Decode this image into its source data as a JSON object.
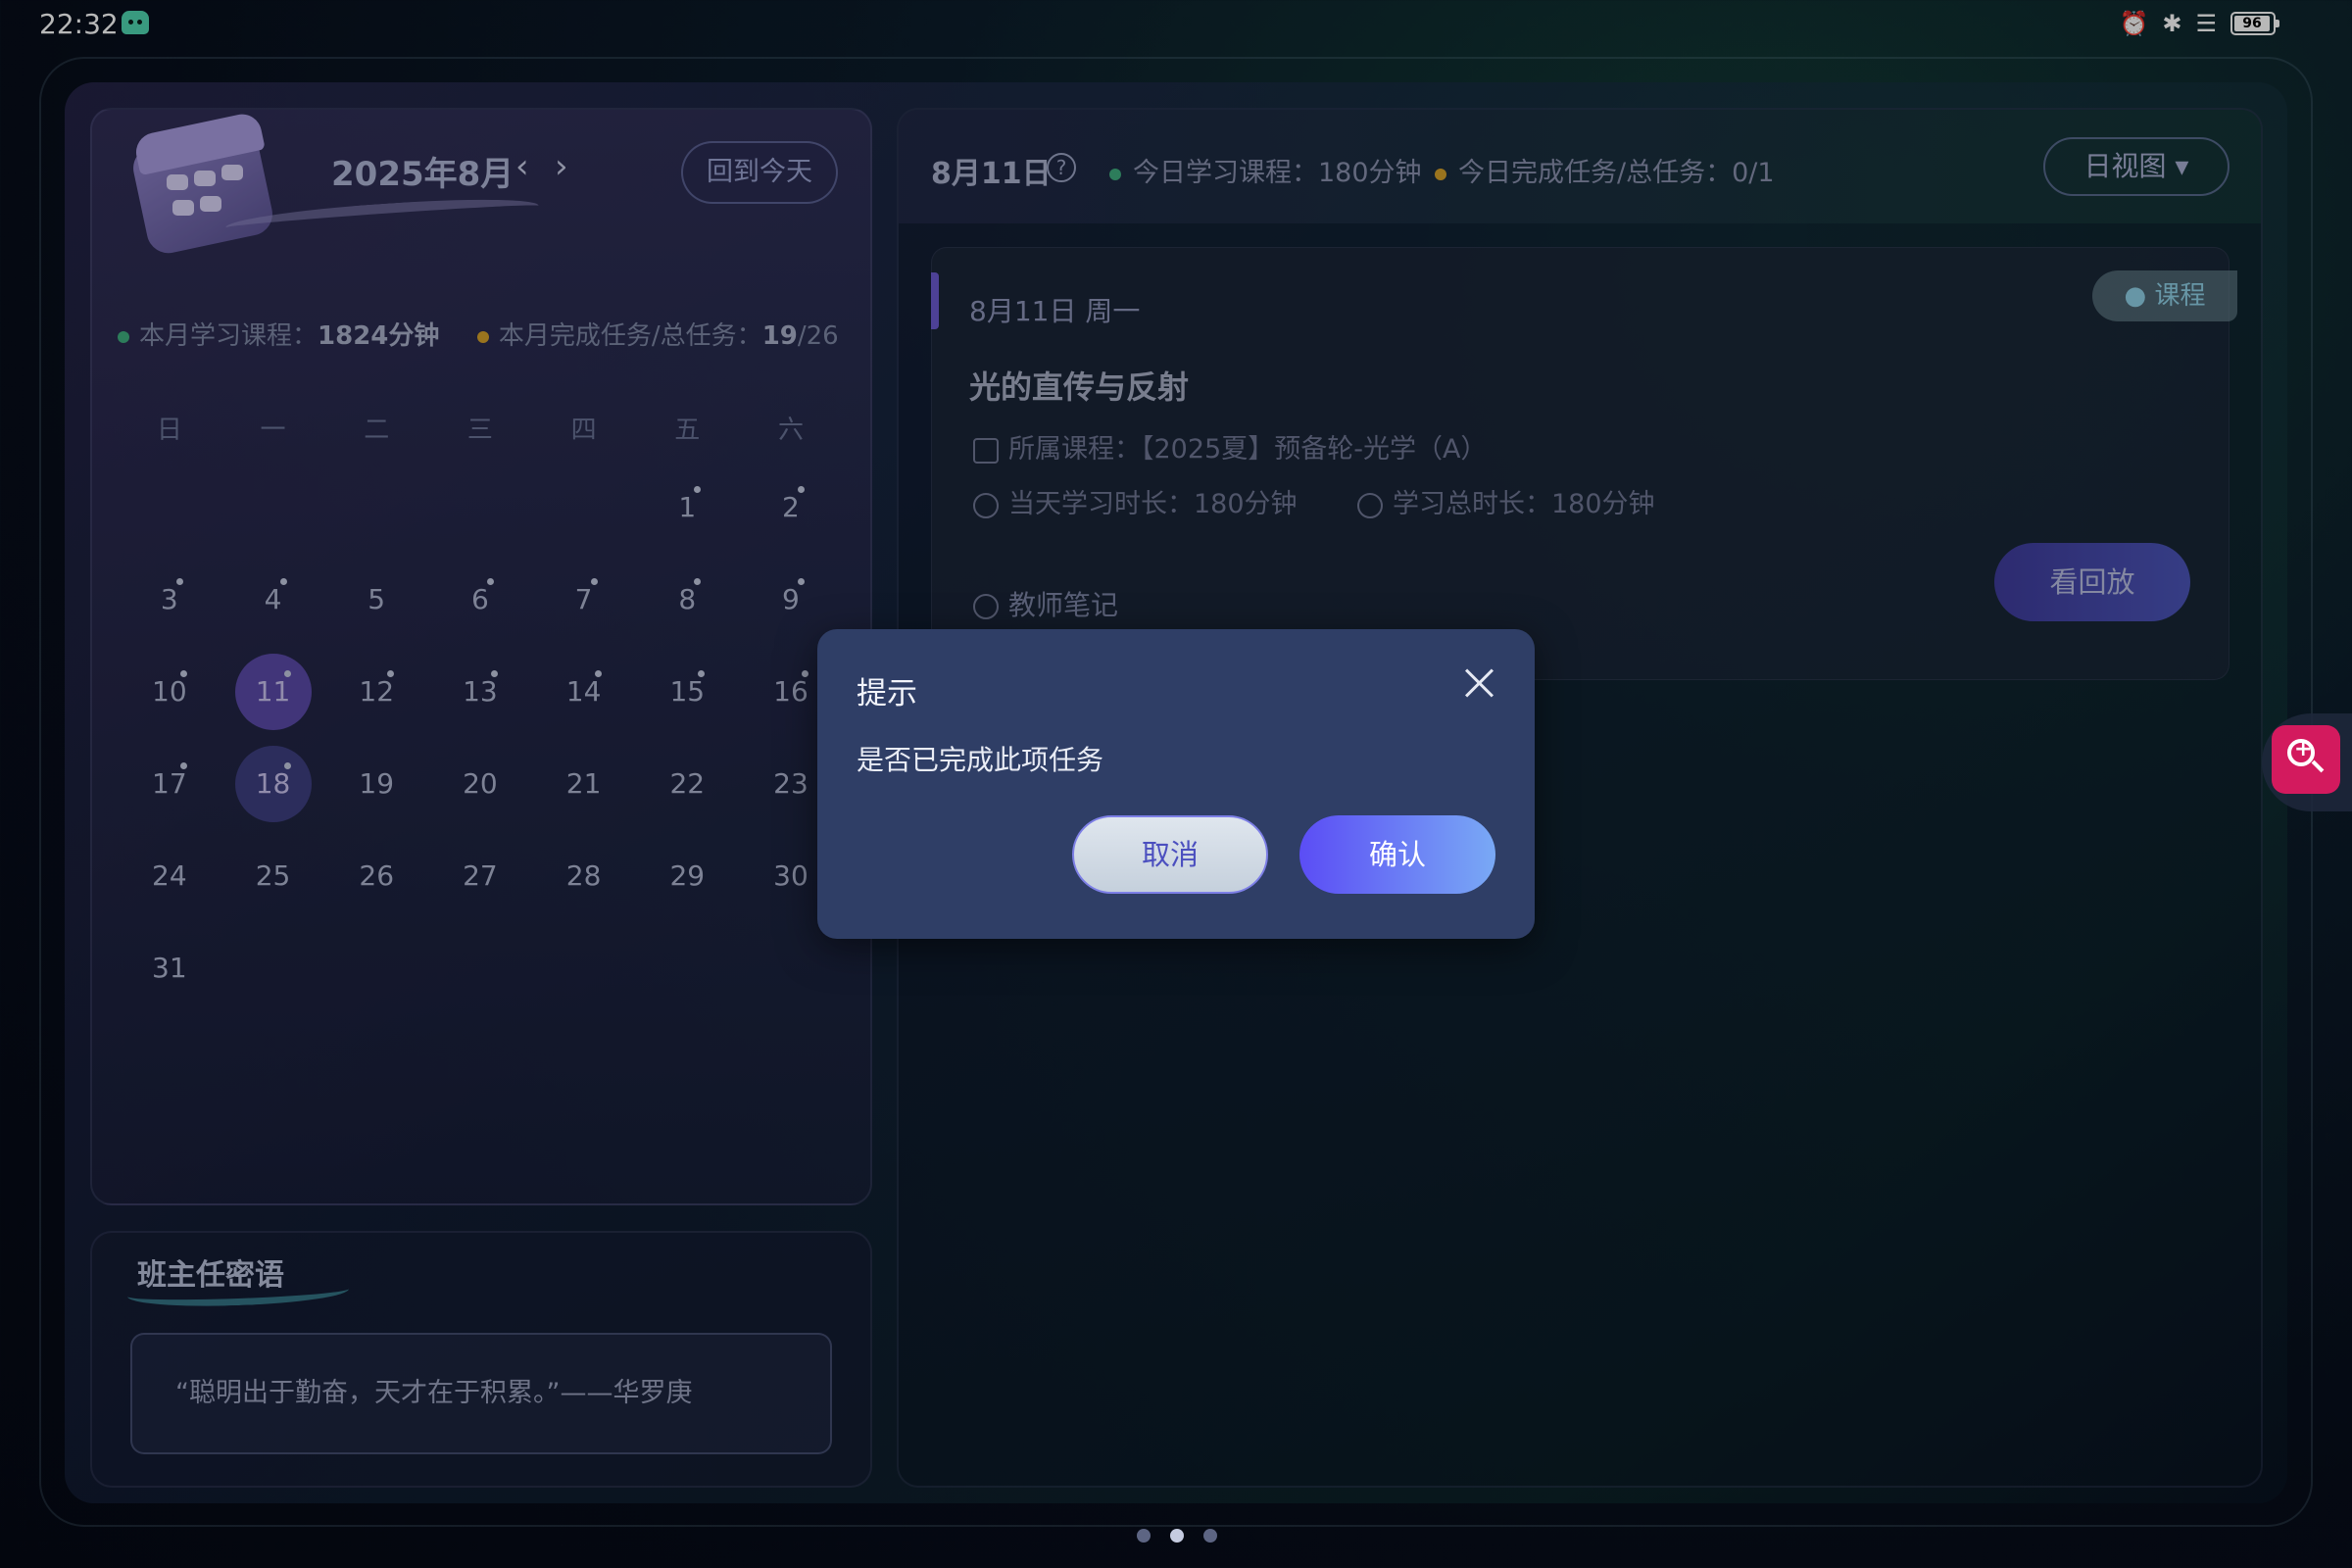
{
  "status_bar": {
    "time": "22:32",
    "battery": "96"
  },
  "calendar": {
    "title": "2025年8月",
    "prev": "‹",
    "next": "›",
    "today_button": "回到今天",
    "month_stats": {
      "study_label": "本月学习课程：",
      "study_value": "1824分钟",
      "task_label": "本月完成任务/总任务：",
      "task_done": "19",
      "task_total": "/26",
      "colors": {
        "study": "#3fae7e",
        "task": "#d6a12a"
      }
    },
    "weekdays": [
      "日",
      "一",
      "二",
      "三",
      "四",
      "五",
      "六"
    ],
    "weeks": [
      [
        "",
        "",
        "",
        "",
        "",
        "1",
        "2"
      ],
      [
        "3",
        "4",
        "5",
        "6",
        "7",
        "8",
        "9"
      ],
      [
        "10",
        "11",
        "12",
        "13",
        "14",
        "15",
        "16"
      ],
      [
        "17",
        "18",
        "19",
        "20",
        "21",
        "22",
        "23"
      ],
      [
        "24",
        "25",
        "26",
        "27",
        "28",
        "29",
        "30"
      ],
      [
        "31",
        "",
        "",
        "",
        "",
        "",
        ""
      ]
    ],
    "days_with_dot": [
      "1",
      "2",
      "3",
      "4",
      "6",
      "7",
      "8",
      "9",
      "10",
      "11",
      "12",
      "13",
      "14",
      "15",
      "16",
      "17",
      "18"
    ],
    "selected_day": "11",
    "today_day": "18"
  },
  "teacher_note": {
    "title": "班主任密语",
    "quote": "“聪明出于勤奋，天才在于积累。”——华罗庚"
  },
  "day_panel": {
    "date": "8月11日",
    "help_icon": "?",
    "study_label": "今日学习课程：180分钟",
    "task_label": "今日完成任务/总任务：0/1",
    "view_button": "日视图 ▾",
    "colors": {
      "study": "#3fae7e",
      "task": "#d6a12a"
    }
  },
  "course": {
    "tag": "课程",
    "date": "8月11日 周一",
    "title": "光的直传与反射",
    "belong": "所属课程：【2025夏】预备轮-光学（A）",
    "today_time": "当天学习时长：180分钟",
    "total_time": "学习总时长：180分钟",
    "notes_link": "教师笔记",
    "replay_button": "看回放"
  },
  "dialog": {
    "title": "提示",
    "message": "是否已完成此项任务",
    "cancel": "取消",
    "confirm": "确认"
  },
  "pager": {
    "count": 3,
    "active": 1
  }
}
